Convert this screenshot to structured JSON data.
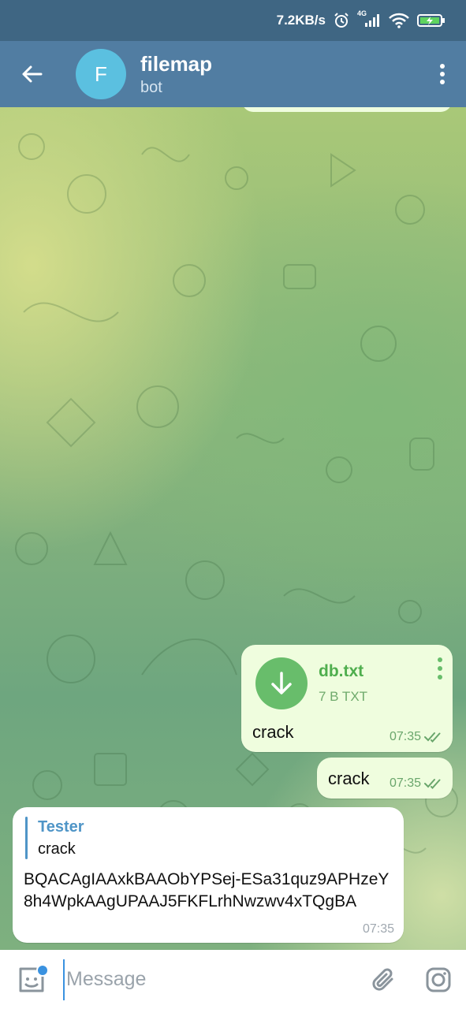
{
  "status_bar": {
    "speed": "7.2KB/s",
    "network_label": "4G",
    "icons": [
      "alarm-icon",
      "signal-icon",
      "wifi-icon",
      "battery-charging-icon"
    ],
    "battery_color": "#5fd35f"
  },
  "header": {
    "avatar_letter": "F",
    "title": "filemap",
    "subtitle": "bot",
    "icons": [
      "back-arrow-icon",
      "more-vert-icon"
    ],
    "accent": "#517da2"
  },
  "messages": {
    "file": {
      "name": "db.txt",
      "meta": "7 B TXT",
      "caption": "crack",
      "time": "07:35",
      "icons": [
        "download-arrow-icon",
        "more-vert-icon",
        "double-check-icon"
      ]
    },
    "text_out": {
      "text": "crack",
      "time": "07:35"
    },
    "incoming": {
      "reply_author": "Tester",
      "reply_text": "crack",
      "text": "BQACAgIAAxkBAAObYPSej-ESa31quz9APHzeY8h4WpkAAgUPAAJ5FKFLrhNwzwv4xTQgBA",
      "time": "07:35"
    }
  },
  "input": {
    "placeholder": "Message",
    "value": "",
    "icons": [
      "sticker-emoji-icon",
      "paperclip-icon",
      "camera-icon"
    ]
  }
}
